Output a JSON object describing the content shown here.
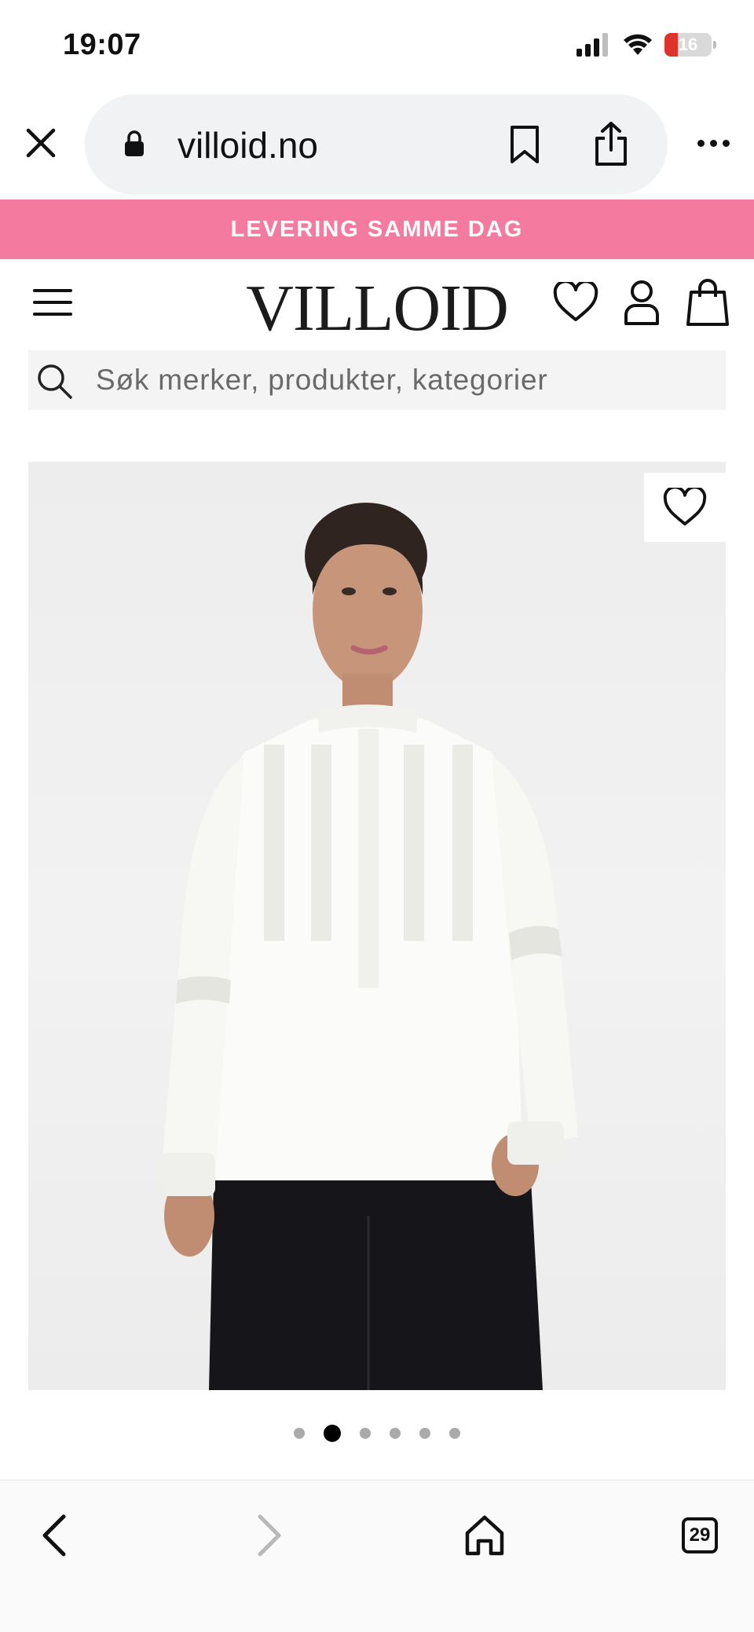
{
  "status_bar": {
    "time": "19:07",
    "battery_level": "16",
    "icons": [
      "cellular-signal-icon",
      "wifi-icon",
      "battery-icon"
    ]
  },
  "browser": {
    "url": "villoid.no",
    "icons": [
      "close-icon",
      "lock-icon",
      "bookmark-icon",
      "share-icon",
      "more-icon"
    ]
  },
  "promo": {
    "text": "LEVERING SAMME DAG",
    "color": "#f47a9f"
  },
  "header": {
    "logo": "VILLOID",
    "icons": [
      "menu-icon",
      "heart-icon",
      "user-icon",
      "shopping-bag-icon"
    ]
  },
  "search": {
    "placeholder": "Søk merker, produkter, kategorier"
  },
  "product": {
    "image_description_icon": "product-photo",
    "wishlist_icon": "heart-icon"
  },
  "carousel": {
    "total_slides": 6,
    "active_index": 1
  },
  "bottom_toolbar": {
    "tab_count": "29",
    "icons": [
      "back-icon",
      "forward-icon",
      "home-icon",
      "tabs-icon"
    ]
  }
}
